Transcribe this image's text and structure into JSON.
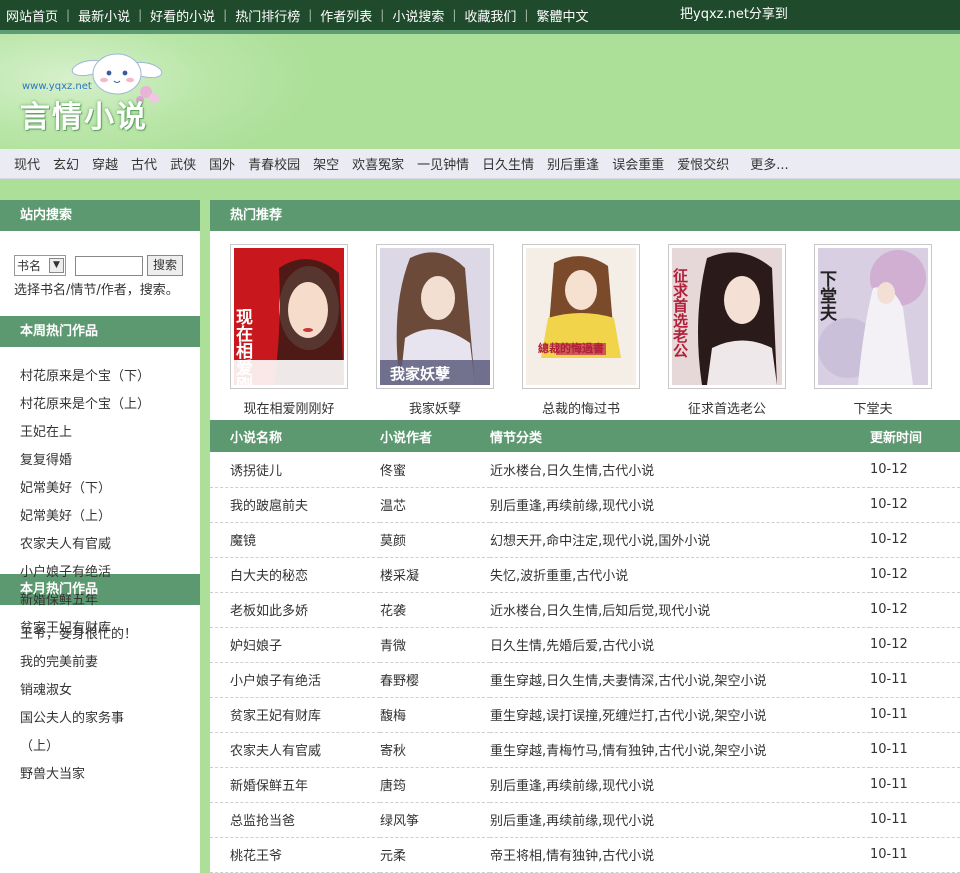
{
  "topnav": {
    "items": [
      "网站首页",
      "最新小说",
      "好看的小说",
      "热门排行榜",
      "作者列表",
      "小说搜索",
      "收藏我们",
      "繁體中文"
    ],
    "separator": "|",
    "share": "把yqxz.net分享到"
  },
  "logo": {
    "url": "www.yqxz.net",
    "text": "言情小说"
  },
  "categories": [
    "现代",
    "玄幻",
    "穿越",
    "古代",
    "武侠",
    "国外",
    "青春校园",
    "架空",
    "欢喜冤家",
    "一见钟情",
    "日久生情",
    "别后重逢",
    "误会重重",
    "爱恨交织"
  ],
  "more": "更多...",
  "search": {
    "title": "站内搜索",
    "select_value": "书名",
    "button": "搜索",
    "tip": "选择书名/情节/作者，搜索。"
  },
  "weekly": {
    "title": "本周热门作品",
    "items": [
      "村花原来是个宝（下）",
      "村花原来是个宝（上）",
      "王妃在上",
      "复复得婚",
      "妃常美好（下）",
      "妃常美好（上）",
      "农家夫人有官威",
      "小户娘子有绝活",
      "新婚保鲜五年",
      "贫家王妃有财库"
    ]
  },
  "monthly": {
    "title": "本月热门作品",
    "items": [
      "王爷，妾身很忙的！",
      "我的完美前妻",
      "销魂淑女",
      "国公夫人的家务事",
      "（上）",
      "野兽大当家"
    ]
  },
  "recommend": {
    "title": "热门推荐",
    "books": [
      {
        "title": "现在相爱刚刚好",
        "cover_text": "现在相爱刚刚好"
      },
      {
        "title": "我家妖孽",
        "cover_text": "我家妖孽"
      },
      {
        "title": "总裁的悔过书",
        "cover_text": "總裁的悔過書"
      },
      {
        "title": "征求首选老公",
        "cover_text": "征求首选老公"
      },
      {
        "title": "下堂夫",
        "cover_text": "下堂夫"
      }
    ]
  },
  "table": {
    "headers": [
      "小说名称",
      "小说作者",
      "情节分类",
      "更新时间"
    ],
    "rows": [
      [
        "诱拐徒儿",
        "佟蜜",
        "近水楼台,日久生情,古代小说",
        "10-12"
      ],
      [
        "我的跛扈前夫",
        "温芯",
        "别后重逢,再续前缘,现代小说",
        "10-12"
      ],
      [
        "魔镜",
        "莫颜",
        "幻想天开,命中注定,现代小说,国外小说",
        "10-12"
      ],
      [
        "白大夫的秘恋",
        "楼采凝",
        "失忆,波折重重,古代小说",
        "10-12"
      ],
      [
        "老板如此多娇",
        "花袭",
        "近水楼台,日久生情,后知后觉,现代小说",
        "10-12"
      ],
      [
        "妒妇娘子",
        "青微",
        "日久生情,先婚后爱,古代小说",
        "10-12"
      ],
      [
        "小户娘子有绝活",
        "春野樱",
        "重生穿越,日久生情,夫妻情深,古代小说,架空小说",
        "10-11"
      ],
      [
        "贫家王妃有财库",
        "馥梅",
        "重生穿越,误打误撞,死缠烂打,古代小说,架空小说",
        "10-11"
      ],
      [
        "农家夫人有官威",
        "寄秋",
        "重生穿越,青梅竹马,情有独钟,古代小说,架空小说",
        "10-11"
      ],
      [
        "新婚保鲜五年",
        "唐筠",
        "别后重逢,再续前缘,现代小说",
        "10-11"
      ],
      [
        "总监抢当爸",
        "绿风筝",
        "别后重逢,再续前缘,现代小说",
        "10-11"
      ],
      [
        "桃花王爷",
        "元柔",
        "帝王将相,情有独钟,古代小说",
        "10-11"
      ]
    ]
  }
}
